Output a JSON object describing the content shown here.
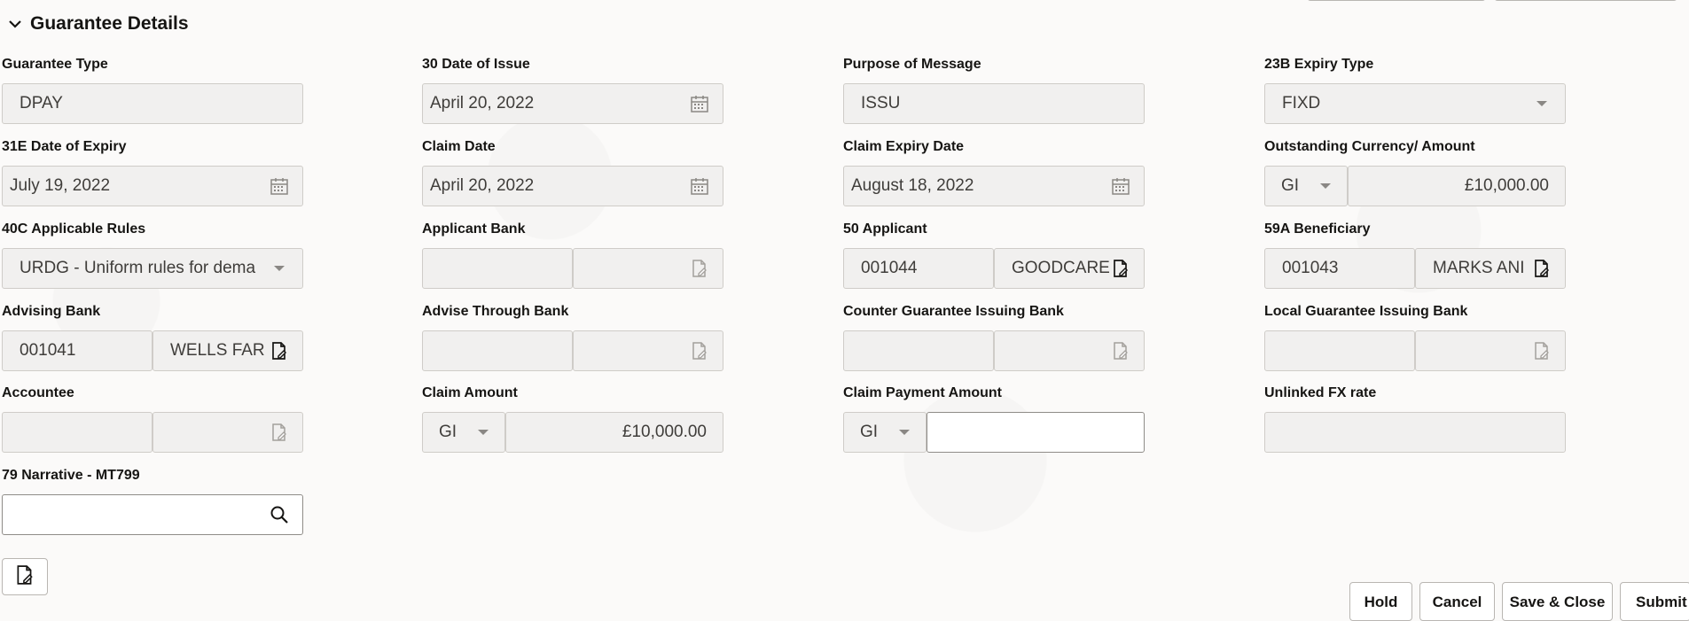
{
  "section": {
    "title": "Guarantee Details"
  },
  "fields": {
    "guarantee_type": {
      "label": "Guarantee Type",
      "value": "DPAY"
    },
    "date_of_issue": {
      "label": "30 Date of Issue",
      "value": "April 20, 2022"
    },
    "purpose_of_message": {
      "label": "Purpose of Message",
      "value": "ISSU"
    },
    "expiry_type": {
      "label": "23B Expiry Type",
      "value": "FIXD"
    },
    "date_of_expiry": {
      "label": "31E Date of Expiry",
      "value": "July 19, 2022"
    },
    "claim_date": {
      "label": "Claim Date",
      "value": "April 20, 2022"
    },
    "claim_expiry_date": {
      "label": "Claim Expiry Date",
      "value": "August 18, 2022"
    },
    "outstanding_currency_amount": {
      "label": "Outstanding Currency/ Amount",
      "currency": "GI",
      "amount": "£10,000.00"
    },
    "applicable_rules": {
      "label": "40C Applicable Rules",
      "value": "URDG - Uniform rules for dema"
    },
    "applicant_bank": {
      "label": "Applicant Bank",
      "code": "",
      "name": ""
    },
    "applicant": {
      "label": "50 Applicant",
      "code": "001044",
      "name": "GOODCARE"
    },
    "beneficiary": {
      "label": "59A Beneficiary",
      "code": "001043",
      "name": "MARKS ANI"
    },
    "advising_bank": {
      "label": "Advising Bank",
      "code": "001041",
      "name": "WELLS FAR"
    },
    "advise_through_bank": {
      "label": "Advise Through Bank",
      "code": "",
      "name": ""
    },
    "counter_guarantee_issuing_bank": {
      "label": "Counter Guarantee Issuing Bank",
      "code": "",
      "name": ""
    },
    "local_guarantee_issuing_bank": {
      "label": "Local Guarantee Issuing Bank",
      "code": "",
      "name": ""
    },
    "accountee": {
      "label": "Accountee",
      "code": "",
      "name": ""
    },
    "claim_amount": {
      "label": "Claim Amount",
      "currency": "GI",
      "amount": "£10,000.00"
    },
    "claim_payment_amount": {
      "label": "Claim Payment Amount",
      "currency": "GI",
      "amount": ""
    },
    "unlinked_fx_rate": {
      "label": "Unlinked FX rate",
      "value": ""
    },
    "narrative_mt799": {
      "label": "79 Narrative - MT799",
      "value": ""
    }
  },
  "footer": {
    "hold": "Hold",
    "cancel": "Cancel",
    "save_close": "Save & Close",
    "submit": "Submit"
  },
  "colors": {
    "field_bg": "#f1f0ef",
    "border": "#cfccc8",
    "text": "#161513"
  }
}
